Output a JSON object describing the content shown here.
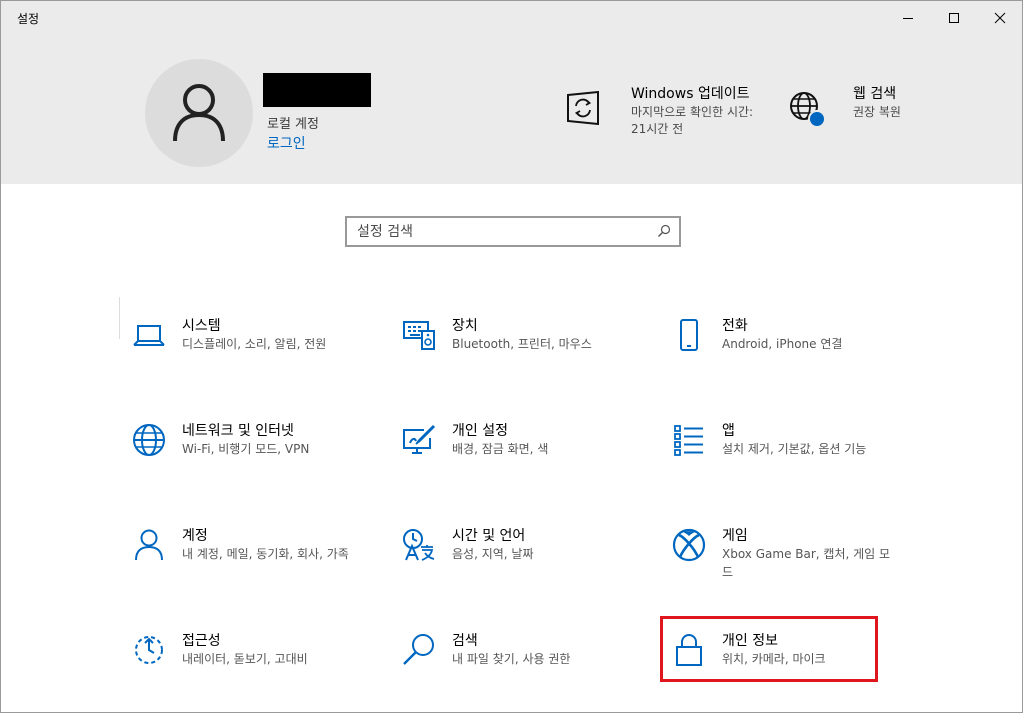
{
  "window": {
    "title": "설정"
  },
  "header": {
    "account_type": "로컬 계정",
    "login_link": "로그인",
    "update": {
      "title": "Windows 업데이트",
      "subtitle": "마지막으로 확인한 시간: 21시간 전",
      "icon": "sync-icon"
    },
    "web_search": {
      "title": "웹 검색",
      "subtitle": "권장 복원",
      "icon": "globe-icon"
    }
  },
  "search": {
    "placeholder": "설정 검색"
  },
  "tiles": [
    {
      "title": "시스템",
      "subtitle": "디스플레이, 소리, 알림, 전원",
      "icon": "laptop-icon"
    },
    {
      "title": "장치",
      "subtitle": "Bluetooth, 프린터, 마우스",
      "icon": "devices-icon"
    },
    {
      "title": "전화",
      "subtitle": "Android, iPhone 연결",
      "icon": "phone-icon"
    },
    {
      "title": "네트워크 및 인터넷",
      "subtitle": "Wi-Fi, 비행기 모드, VPN",
      "icon": "globe-icon"
    },
    {
      "title": "개인 설정",
      "subtitle": "배경, 잠금 화면, 색",
      "icon": "personalization-icon"
    },
    {
      "title": "앱",
      "subtitle": "설치 제거, 기본값, 옵션 기능",
      "icon": "apps-list-icon"
    },
    {
      "title": "계정",
      "subtitle": "내 계정, 메일, 동기화, 회사, 가족",
      "icon": "person-icon"
    },
    {
      "title": "시간 및 언어",
      "subtitle": "음성, 지역, 날짜",
      "icon": "time-language-icon"
    },
    {
      "title": "게임",
      "subtitle": "Xbox Game Bar, 캡처, 게임 모드",
      "icon": "xbox-icon"
    },
    {
      "title": "접근성",
      "subtitle": "내레이터, 돋보기, 고대비",
      "icon": "accessibility-icon"
    },
    {
      "title": "검색",
      "subtitle": "내 파일 찾기, 사용 권한",
      "icon": "search-icon"
    },
    {
      "title": "개인 정보",
      "subtitle": "위치, 카메라, 마이크",
      "icon": "lock-icon"
    }
  ],
  "colors": {
    "accent": "#0067c0",
    "header_bg": "#ebebeb",
    "highlight": "#e0161e"
  }
}
